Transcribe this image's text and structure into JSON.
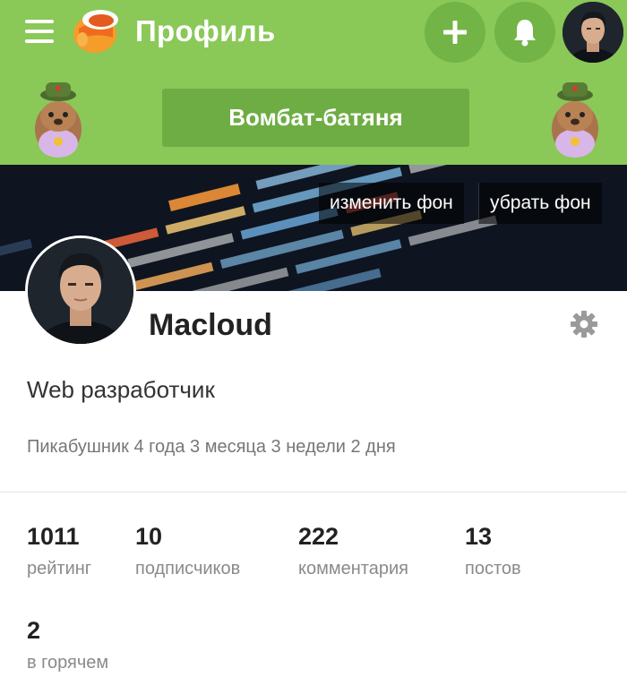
{
  "header": {
    "title": "Профиль",
    "menu_icon": "hamburger-menu-icon",
    "logo_icon": "pikabu-logo-icon",
    "plus_icon": "plus-icon",
    "bell_icon": "bell-icon",
    "background": "#8ac858"
  },
  "award": {
    "label": "Вомбат-батяня"
  },
  "banner": {
    "change_label": "изменить фон",
    "remove_label": "убрать фон"
  },
  "profile": {
    "username": "Macloud",
    "bio": "Web разработчик",
    "since": "Пикабушник 4 года 3 месяца 3 недели 2 дня",
    "settings_icon": "gear-icon"
  },
  "stats": [
    {
      "value": "1011",
      "label": "рейтинг"
    },
    {
      "value": "10",
      "label": "подписчиков"
    },
    {
      "value": "222",
      "label": "комментария"
    },
    {
      "value": "13",
      "label": "постов"
    },
    {
      "value": "2",
      "label": "в горячем"
    }
  ]
}
